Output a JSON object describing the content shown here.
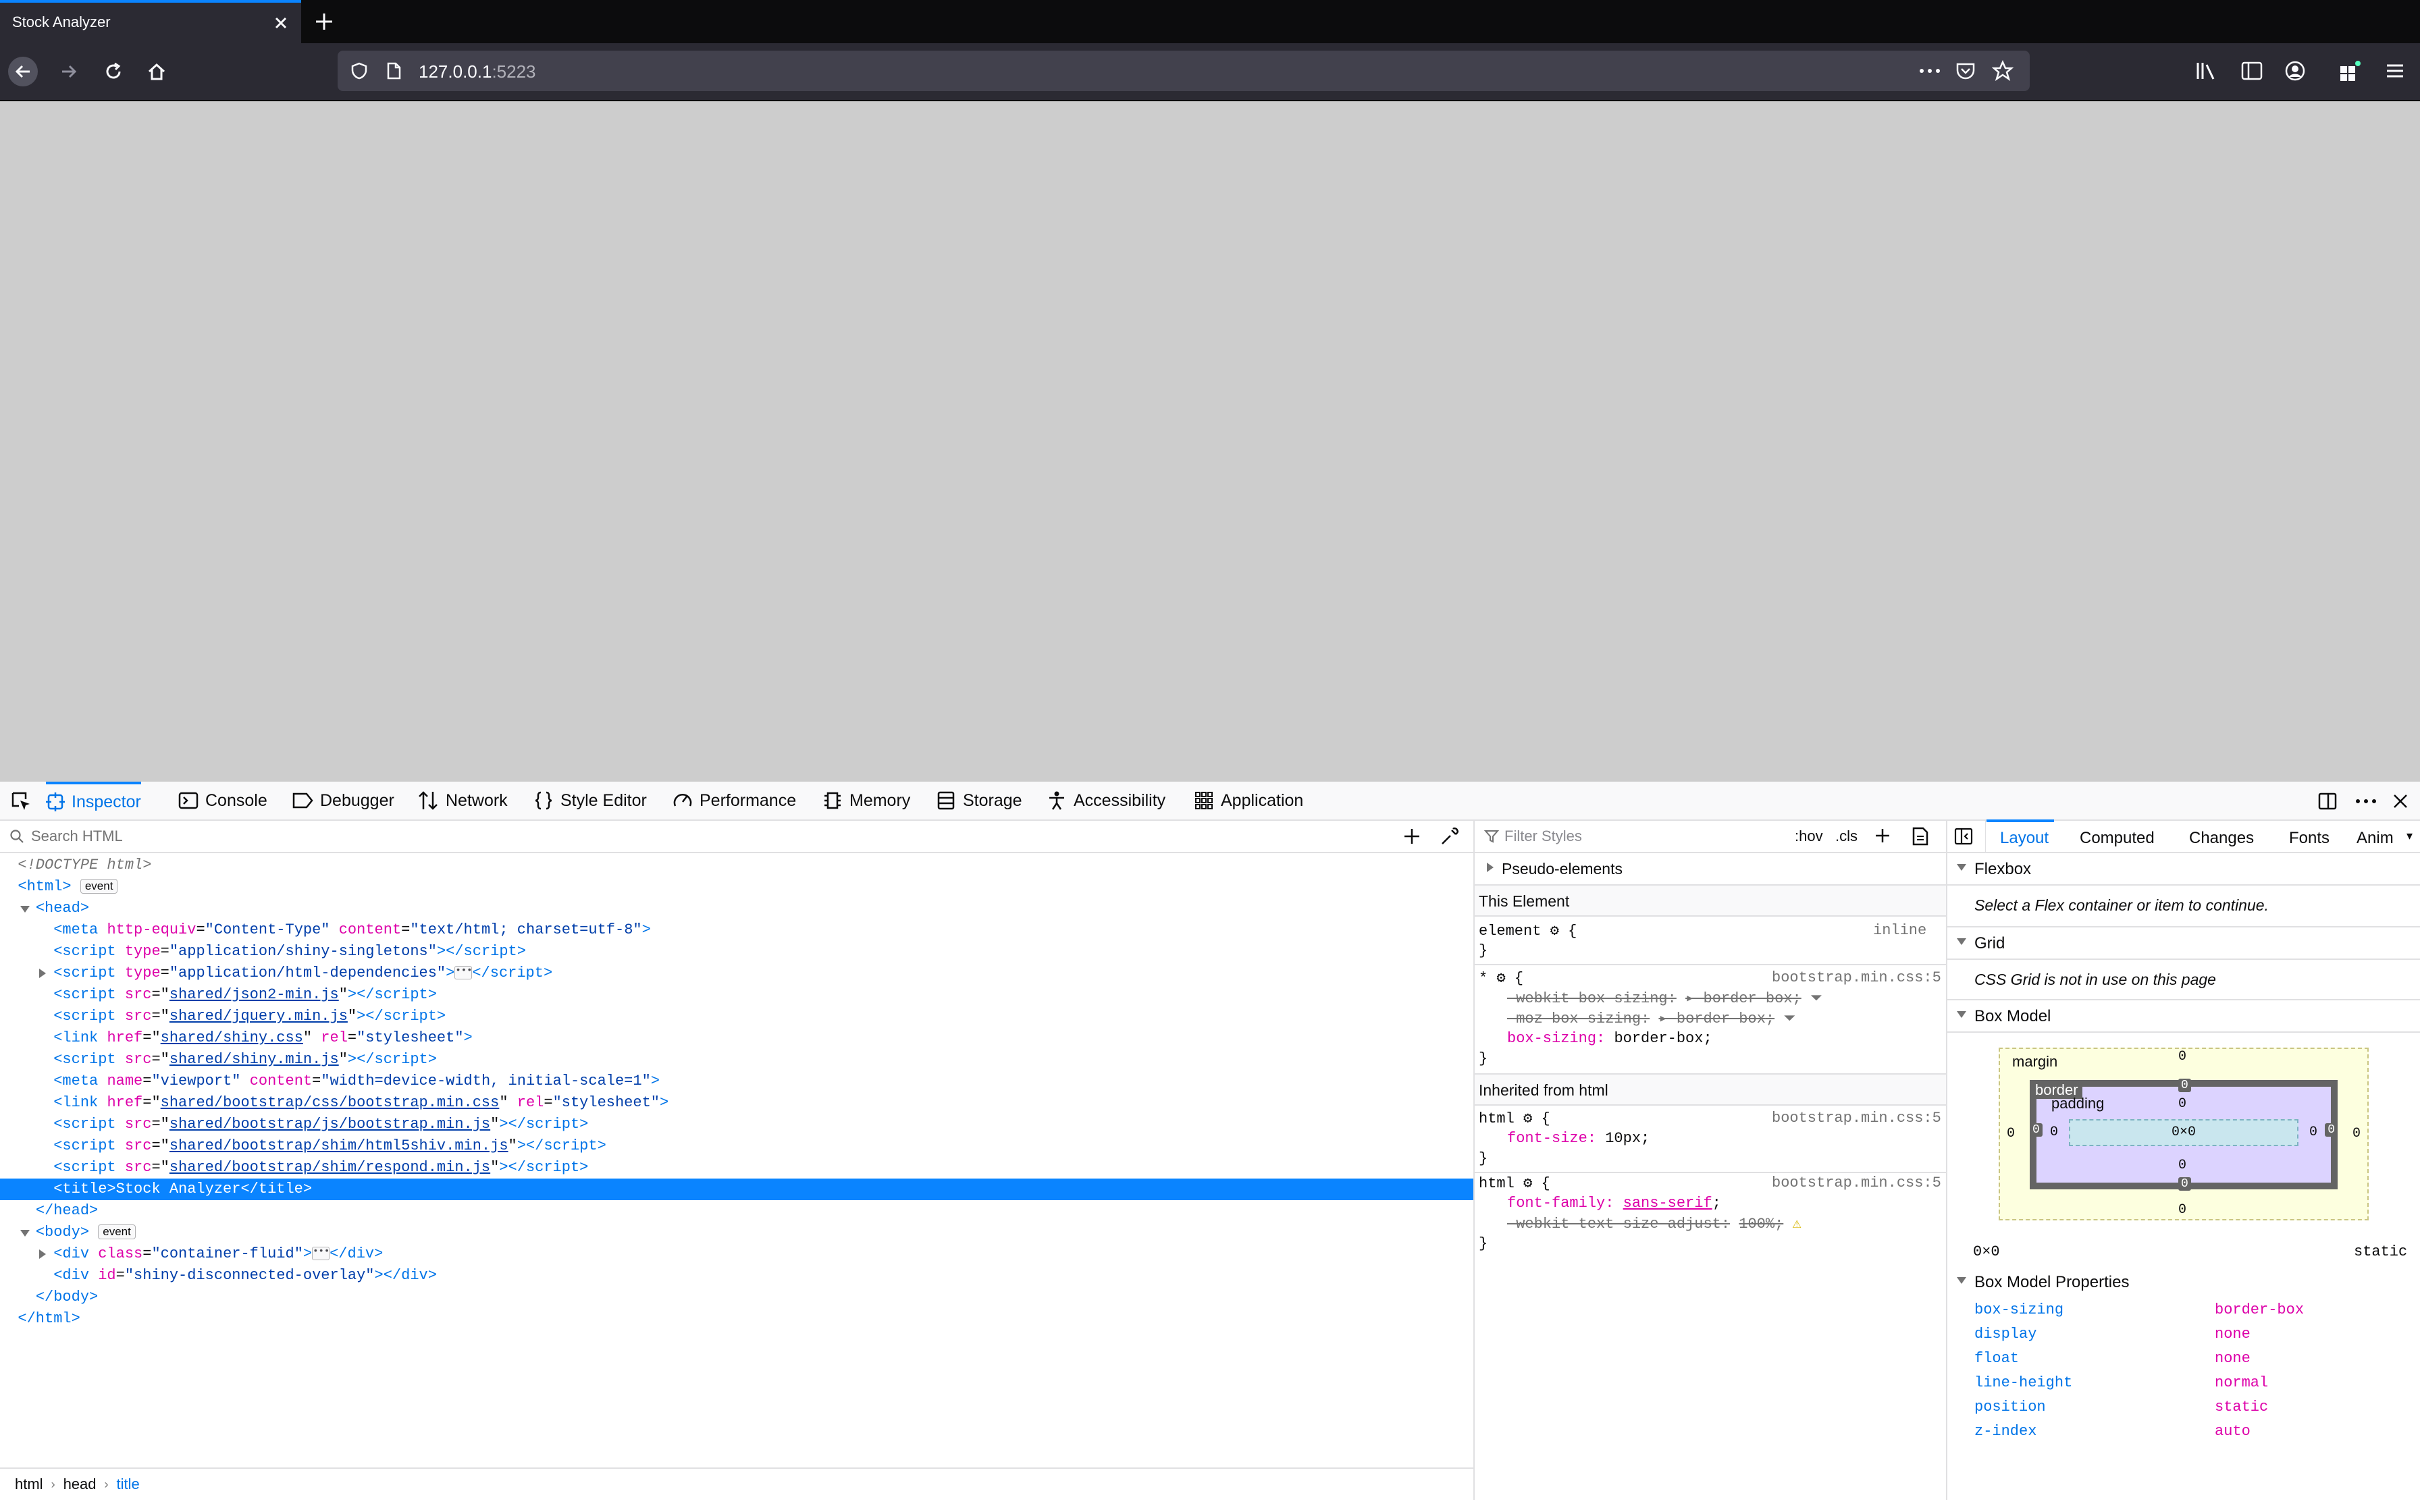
{
  "browser": {
    "tab_title": "Stock Analyzer",
    "url_host": "127.0.0.1",
    "url_port": ":5223"
  },
  "devtools": {
    "tools": [
      {
        "label": "Inspector"
      },
      {
        "label": "Console"
      },
      {
        "label": "Debugger"
      },
      {
        "label": "Network"
      },
      {
        "label": "Style Editor"
      },
      {
        "label": "Performance"
      },
      {
        "label": "Memory"
      },
      {
        "label": "Storage"
      },
      {
        "label": "Accessibility"
      },
      {
        "label": "Application"
      }
    ],
    "search_placeholder": "Search HTML",
    "breadcrumbs": [
      "html",
      "head",
      "title"
    ]
  },
  "markup": {
    "doctype": "<!DOCTYPE html>",
    "badge_event": "event",
    "lines": {
      "meta1": {
        "tag": "meta",
        "a1": "http-equiv",
        "v1": "\"Content-Type\"",
        "a2": "content",
        "v2": "\"text/html; charset=utf-8\""
      },
      "script1": {
        "a1": "type",
        "v1": "\"application/shiny-singletons\""
      },
      "script2": {
        "a1": "type",
        "v1": "\"application/html-dependencies\""
      },
      "script3": {
        "v": "shared/json2-min.js"
      },
      "script4": {
        "v": "shared/jquery.min.js"
      },
      "link1": {
        "v": "shared/shiny.css",
        "rel": "\"stylesheet\""
      },
      "script5": {
        "v": "shared/shiny.min.js"
      },
      "meta2": {
        "v1": "\"viewport\"",
        "v2": "\"width=device-width, initial-scale=1\""
      },
      "link2": {
        "v": "shared/bootstrap/css/bootstrap.min.css",
        "rel": "\"stylesheet\""
      },
      "script6": {
        "v": "shared/bootstrap/js/bootstrap.min.js"
      },
      "script7": {
        "v": "shared/bootstrap/shim/html5shiv.min.js"
      },
      "script8": {
        "v": "shared/bootstrap/shim/respond.min.js"
      },
      "title": "<title>Stock Analyzer</title>",
      "div1": {
        "a": "class",
        "v": "\"container-fluid\""
      },
      "div2": {
        "a": "id",
        "v": "\"shiny-disconnected-overlay\""
      }
    }
  },
  "rules": {
    "filter_placeholder": "Filter Styles",
    "hov": ":hov",
    "cls": ".cls",
    "pseudo": "Pseudo-elements",
    "this_element": "This Element",
    "element_sel": "element",
    "inline": "inline",
    "star_sel": "*",
    "src": "bootstrap.min.css:5",
    "webkit_bs": "-webkit-box-sizing:",
    "moz_bs": "-moz-box-sizing:",
    "bs": "box-sizing:",
    "bb": "border-box;",
    "bb_strike": "border-box",
    "inherited": "Inherited from html",
    "html_sel": "html",
    "font_size": "font-size:",
    "font_size_val": "10px;",
    "font_family": "font-family:",
    "font_family_val": "sans-serif",
    "tsa": "-webkit-text-size-adjust:",
    "tsa_val": "100%"
  },
  "layout": {
    "tabs": [
      "Layout",
      "Computed",
      "Changes",
      "Fonts",
      "Anim"
    ],
    "flexbox": "Flexbox",
    "flexbox_note": "Select a Flex container or item to continue.",
    "grid": "Grid",
    "grid_note": "CSS Grid is not in use on this page",
    "box_model": "Box Model",
    "margin": "margin",
    "border": "border",
    "padding": "padding",
    "content_size": "0×0",
    "zero": "0",
    "size_readout": "0×0",
    "position_readout": "static",
    "bmp_title": "Box Model Properties",
    "properties": [
      {
        "name": "box-sizing",
        "value": "border-box"
      },
      {
        "name": "display",
        "value": "none"
      },
      {
        "name": "float",
        "value": "none"
      },
      {
        "name": "line-height",
        "value": "normal"
      },
      {
        "name": "position",
        "value": "static"
      },
      {
        "name": "z-index",
        "value": "auto"
      }
    ]
  }
}
